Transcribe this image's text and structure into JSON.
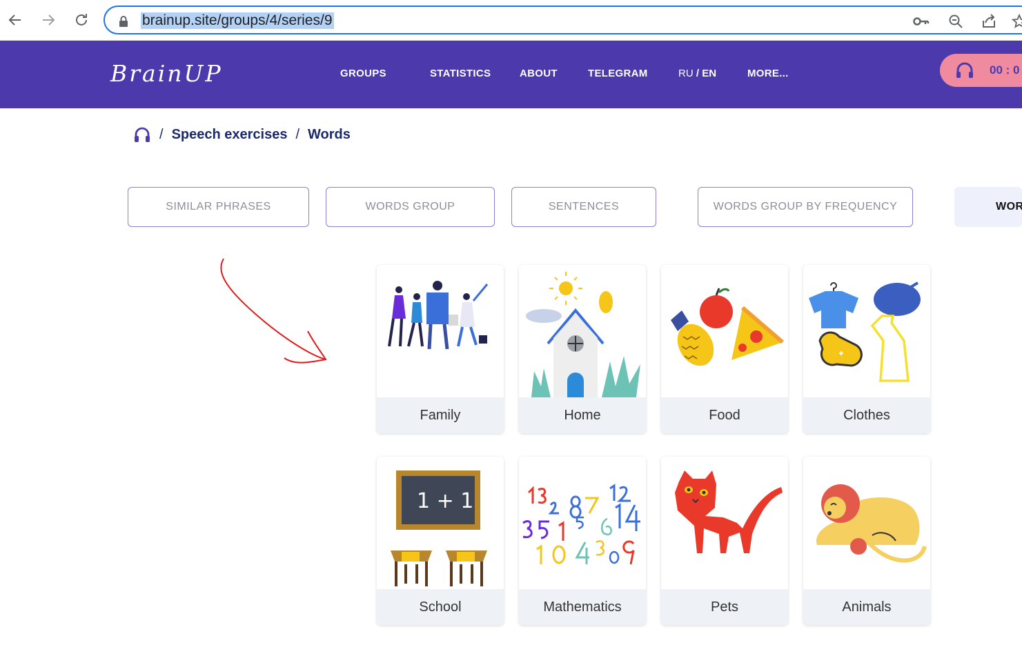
{
  "browser": {
    "url": "brainup.site/groups/4/series/9"
  },
  "header": {
    "logo": "BrainUP",
    "nav": [
      "GROUPS",
      "STATISTICS",
      "ABOUT",
      "TELEGRAM",
      "MORE..."
    ],
    "lang_ru": "RU",
    "lang_sep": "/",
    "lang_en": "EN",
    "timer": "00 : 0"
  },
  "breadcrumb": {
    "items": [
      "Speech exercises",
      "Words"
    ],
    "separator": "/"
  },
  "tabs": [
    "SIMILAR PHRASES",
    "WORDS GROUP",
    "SENTENCES",
    "WORDS GROUP BY FREQUENCY",
    "WOR"
  ],
  "cards": [
    "Family",
    "Home",
    "Food",
    "Clothes",
    "School",
    "Mathematics",
    "Pets",
    "Animals"
  ],
  "colors": {
    "header_bg": "#4c3aac",
    "timer_bg": "#f08a9e",
    "breadcrumb_text": "#1a2a6c",
    "tab_border": "#8a7fd4",
    "annotation": "#e01b1b"
  }
}
